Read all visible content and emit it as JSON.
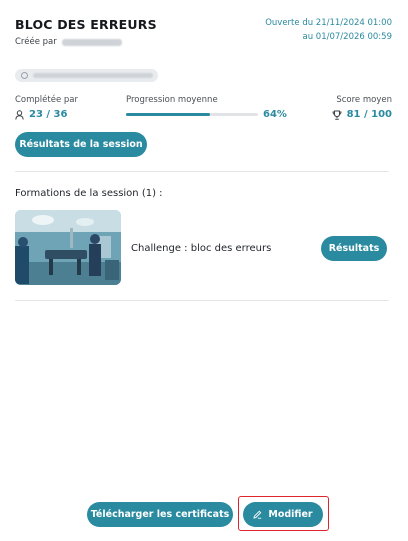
{
  "session": {
    "title": "BLOC DES ERREURS",
    "created_by_label": "Créée par",
    "opened_from": "Ouverte du 21/11/2024 01:00",
    "opened_to": "au 01/07/2026 00:59"
  },
  "stats": {
    "completed_label": "Complétée par",
    "completed_value": "23 / 36",
    "progress_label": "Progression moyenne",
    "progress_value": "64%",
    "progress_fraction": 0.64,
    "score_label": "Score moyen",
    "score_value": "81 / 100"
  },
  "buttons": {
    "session_results": "Résultats de la session",
    "formation_results": "Résultats",
    "download_certificates": "Télécharger les certificats",
    "edit": "Modifier"
  },
  "formations": {
    "heading": "Formations de la session (1) :",
    "items": [
      {
        "name": "Challenge : bloc des erreurs"
      }
    ]
  },
  "colors": {
    "accent": "#2a8aa0",
    "highlight_outline": "#e0242e"
  },
  "icons": {
    "completed": "user-icon",
    "score": "trophy-icon",
    "edit": "pencil-icon",
    "tag": "group-icon"
  }
}
